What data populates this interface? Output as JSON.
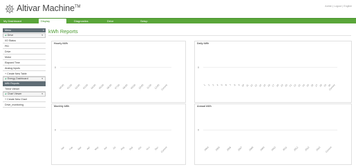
{
  "header": {
    "app_name": "Altivar Machine",
    "tm": "TM",
    "user_links": "Admin  |  Logout  |  English"
  },
  "nav": {
    "tabs": [
      {
        "label": "My Dashboard",
        "active": false
      },
      {
        "label": "Display",
        "active": true
      },
      {
        "label": "Diagnostics",
        "active": false
      },
      {
        "label": "Drive",
        "active": false
      },
      {
        "label": "Setup",
        "active": false
      }
    ]
  },
  "sidebar": {
    "header": "Menu",
    "sections": [
      {
        "group": "Drive",
        "items": [
          "I/O Status",
          "PID",
          "Drive",
          "Motor",
          "Elapsed Time",
          "Analog Inputs",
          "+ Create New Table"
        ]
      },
      {
        "group": "Energy Dashboard",
        "items": [
          "kWh Reports",
          "Trend Viewer"
        ]
      },
      {
        "group": "Chart Viewer",
        "items": [
          "+ Create New Chart",
          "Drive_monitoring"
        ]
      }
    ]
  },
  "main": {
    "title": "kWh Reports"
  },
  "charts": [
    {
      "title": "Hourly kWh",
      "zero_label": "0",
      "ticks": [
        "00:00",
        "01:00",
        "02:00",
        "03:00",
        "04:00",
        "05:00",
        "06:00",
        "07:00",
        "08:00",
        "09:00",
        "10:00",
        "11:00",
        "12:00",
        "Current"
      ]
    },
    {
      "title": "Daily kWh",
      "zero_label": "0",
      "ticks": [
        "1",
        "2",
        "3",
        "4",
        "5",
        "6",
        "7",
        "8",
        "9",
        "10",
        "11",
        "12",
        "13",
        "14",
        "15",
        "16",
        "17",
        "18",
        "19",
        "20",
        "21",
        "22",
        "23",
        "24",
        "25",
        "26",
        "27",
        "28",
        "29",
        "30",
        "Current"
      ]
    },
    {
      "title": "Monthly kWh",
      "zero_label": "0",
      "ticks": [
        "Jan",
        "Feb",
        "Mar",
        "Apr",
        "May",
        "Jun",
        "Jul",
        "Aug",
        "Sep",
        "Oct",
        "Nov",
        "Dec",
        "Current"
      ]
    },
    {
      "title": "Annual kWh",
      "zero_label": "0",
      "ticks": [
        "2004",
        "2005",
        "2006",
        "2007",
        "2008",
        "2009",
        "2010",
        "2011",
        "2012",
        "2013",
        "2014",
        "Current"
      ]
    }
  ],
  "colors": {
    "brand_green": "#5aa63a",
    "title_green": "#4a9a2f",
    "sidebar_dark": "#5f6d75"
  }
}
